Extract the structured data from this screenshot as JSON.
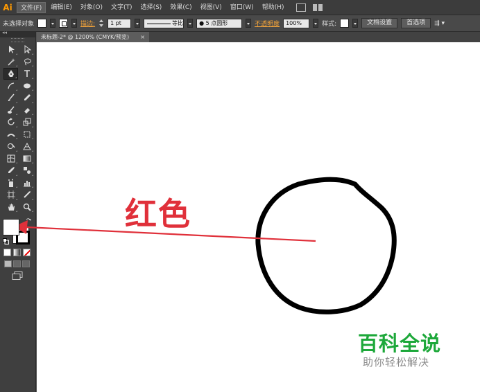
{
  "app": {
    "logo": "Ai"
  },
  "menu": [
    {
      "label": "文件(F)",
      "active": true
    },
    {
      "label": "编辑(E)"
    },
    {
      "label": "对象(O)"
    },
    {
      "label": "文字(T)"
    },
    {
      "label": "选择(S)"
    },
    {
      "label": "效果(C)"
    },
    {
      "label": "视图(V)"
    },
    {
      "label": "窗口(W)"
    },
    {
      "label": "帮助(H)"
    }
  ],
  "control": {
    "selection": "未选择对象",
    "stroke_label": "描边:",
    "stroke_weight": "1 pt",
    "stroke_profile": "等比",
    "brush": "● 5 点圆形",
    "opacity_label": "不透明度",
    "opacity_value": "100%",
    "style_label": "样式:",
    "doc_setup": "文档设置",
    "preferences": "首选项"
  },
  "document": {
    "tab_title": "未标题-2* @ 1200% (CMYK/预览)",
    "close": "×"
  },
  "tools": [
    "selection-tool-icon",
    "direct-selection-tool-icon",
    "magic-wand-tool-icon",
    "lasso-tool-icon",
    "pen-tool-icon",
    "type-tool-icon",
    "line-segment-tool-icon",
    "ellipse-tool-icon",
    "paintbrush-tool-icon",
    "pencil-tool-icon",
    "blob-brush-tool-icon",
    "eraser-tool-icon",
    "rotate-tool-icon",
    "scale-tool-icon",
    "width-tool-icon",
    "free-transform-tool-icon",
    "shape-builder-tool-icon",
    "perspective-grid-tool-icon",
    "mesh-tool-icon",
    "gradient-tool-icon",
    "eyedropper-tool-icon",
    "blend-tool-icon",
    "symbol-sprayer-tool-icon",
    "column-graph-tool-icon",
    "artboard-tool-icon",
    "slice-tool-icon",
    "hand-tool-icon",
    "zoom-tool-icon"
  ],
  "annotation": {
    "label": "红色",
    "color": "#e0303a"
  },
  "watermark": {
    "title": "百科全说",
    "subtitle": "助你轻松解决",
    "title_color": "#1da83a"
  }
}
